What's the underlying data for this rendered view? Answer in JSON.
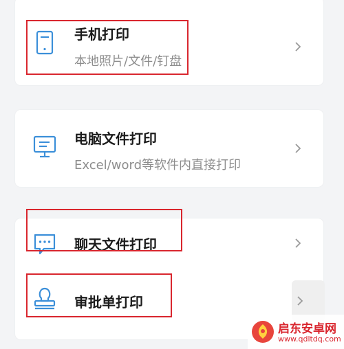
{
  "colors": {
    "accent": "#3b8fd9",
    "highlight": "#d9262e",
    "title": "#1c1c1c",
    "subtitle": "#8d8d8d",
    "chevron": "#9a9a9a"
  },
  "items": [
    {
      "title": "手机打印",
      "subtitle": "本地照片/文件/钉盘",
      "icon": "phone-icon"
    },
    {
      "title": "电脑文件打印",
      "subtitle": "Excel/word等软件内直接打印",
      "icon": "monitor-icon"
    },
    {
      "title": "聊天文件打印",
      "icon": "chat-bubble-icon"
    },
    {
      "title": "审批单打印",
      "icon": "stamp-icon"
    }
  ],
  "watermark": {
    "name": "启东安卓网",
    "url": "www.qdltdq.com"
  }
}
